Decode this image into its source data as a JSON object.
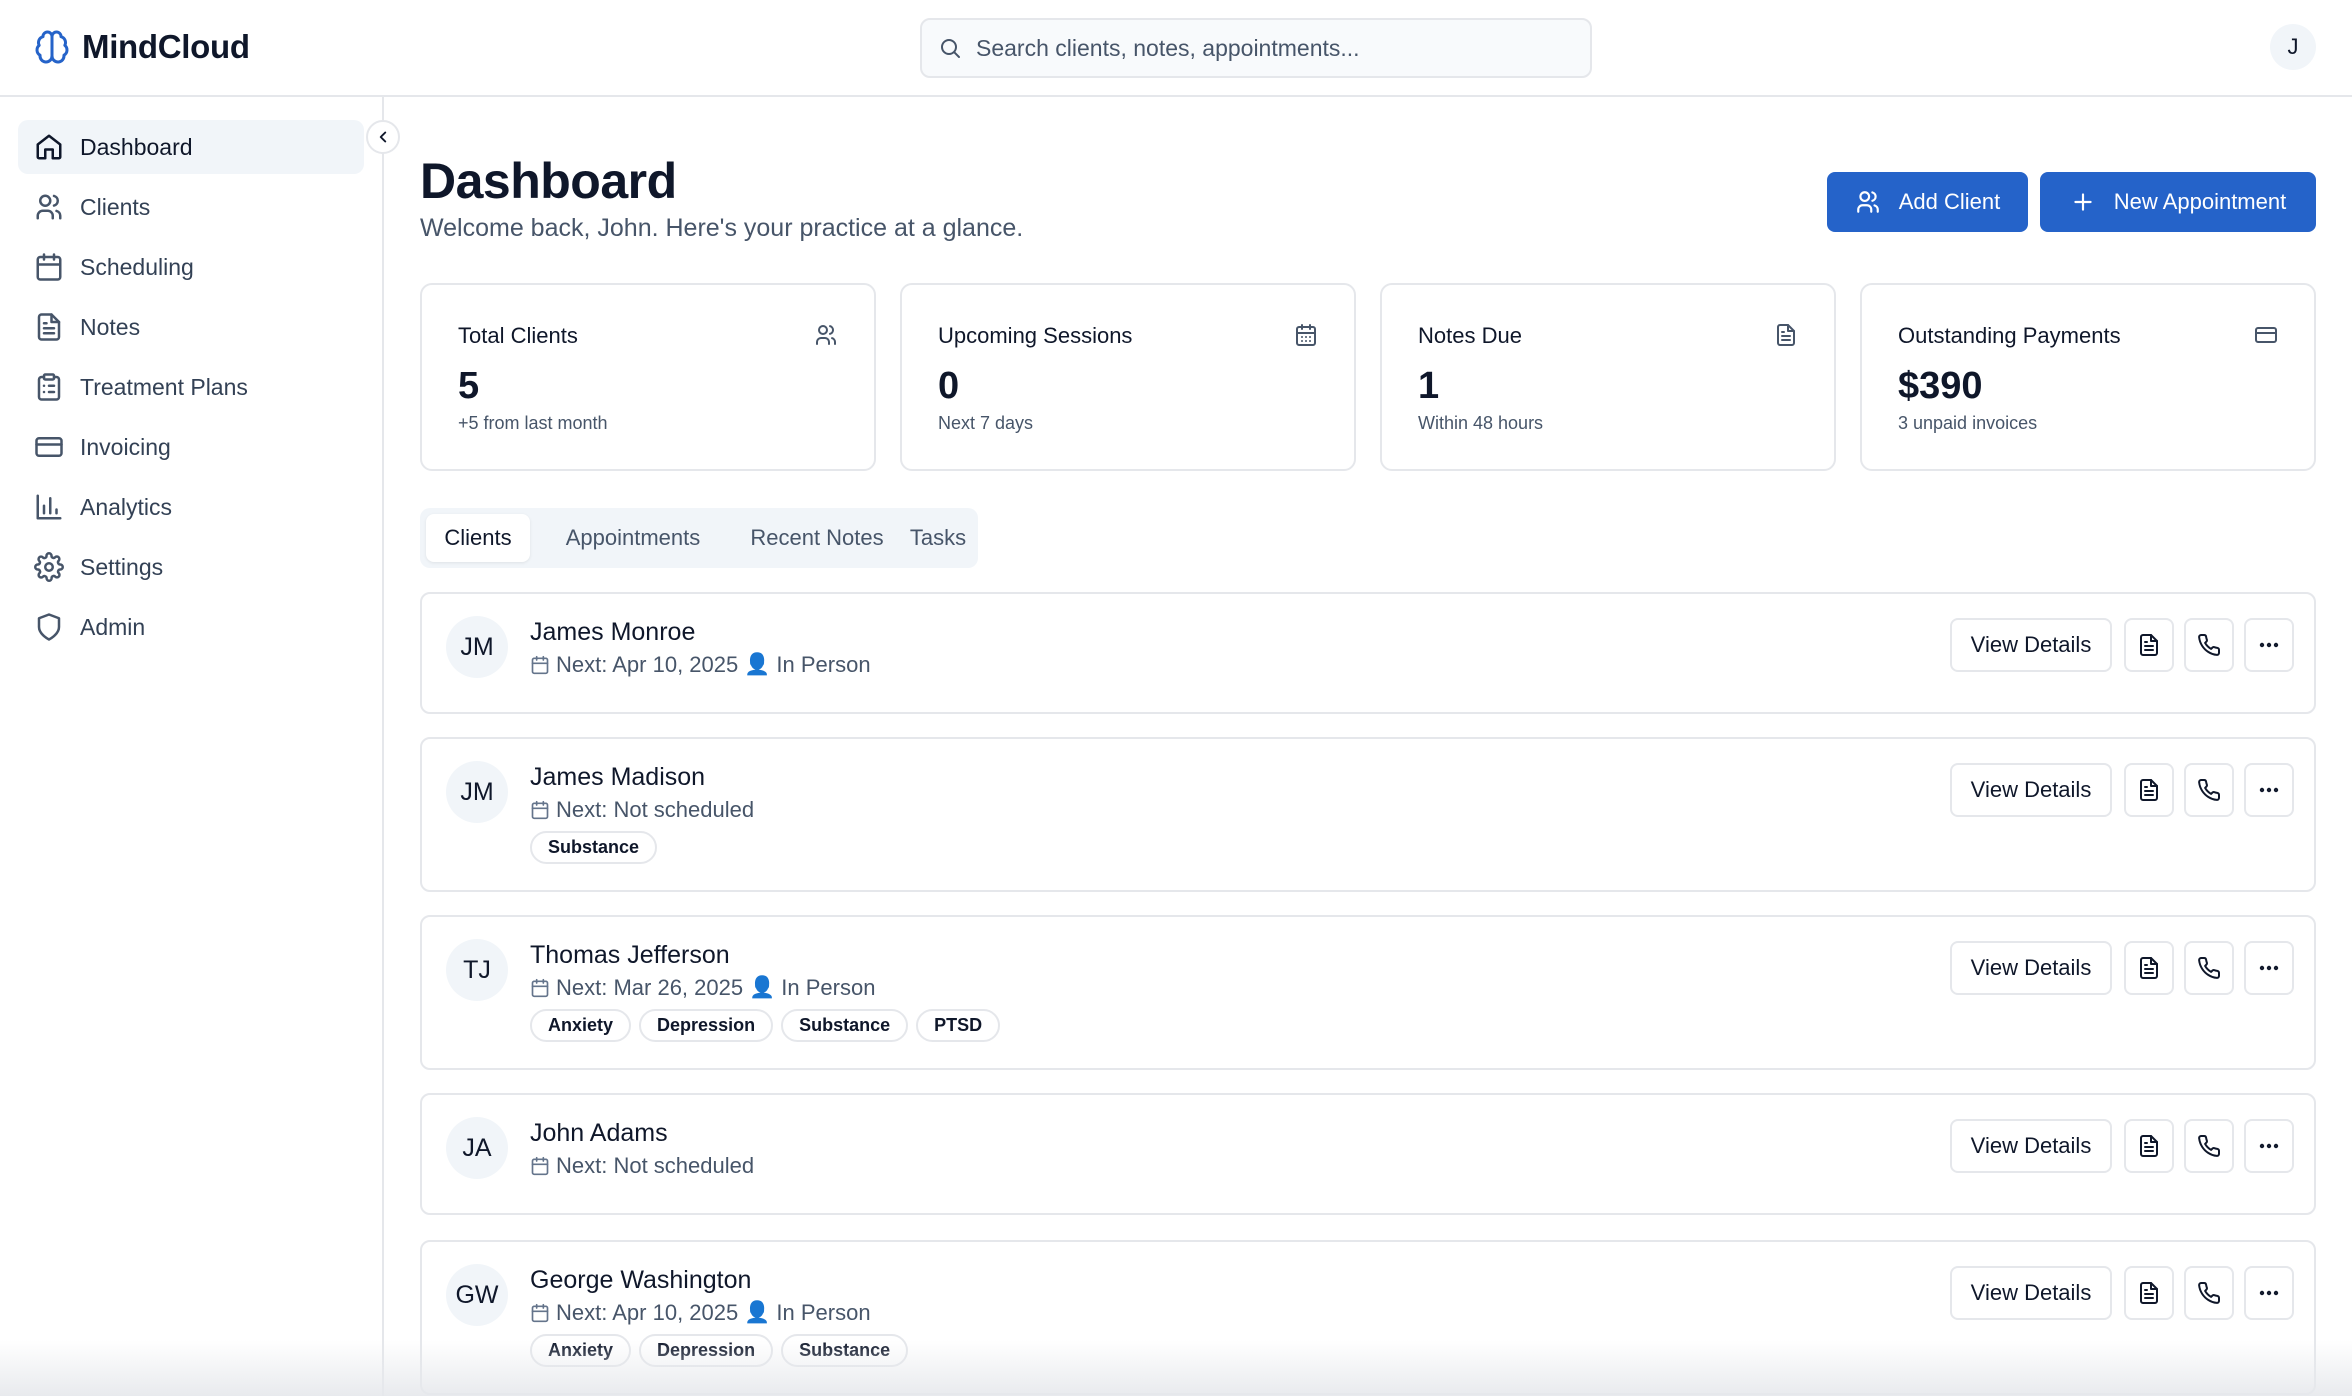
{
  "app": {
    "name": "MindCloud"
  },
  "search": {
    "placeholder": "Search clients, notes, appointments..."
  },
  "user": {
    "initial": "J"
  },
  "sidebar": {
    "items": [
      {
        "label": "Dashboard",
        "icon": "home-icon",
        "active": true
      },
      {
        "label": "Clients",
        "icon": "users-icon"
      },
      {
        "label": "Scheduling",
        "icon": "calendar-icon"
      },
      {
        "label": "Notes",
        "icon": "file-text-icon"
      },
      {
        "label": "Treatment Plans",
        "icon": "clipboard-icon"
      },
      {
        "label": "Invoicing",
        "icon": "credit-card-icon"
      },
      {
        "label": "Analytics",
        "icon": "bar-chart-icon"
      },
      {
        "label": "Settings",
        "icon": "gear-icon"
      },
      {
        "label": "Admin",
        "icon": "shield-icon"
      }
    ]
  },
  "page": {
    "title": "Dashboard",
    "subtitle": "Welcome back, John. Here's your practice at a glance.",
    "add_client_label": "Add Client",
    "new_appointment_label": "New Appointment"
  },
  "stats": [
    {
      "label": "Total Clients",
      "value": "5",
      "sub": "+5 from last month",
      "icon": "users-icon"
    },
    {
      "label": "Upcoming Sessions",
      "value": "0",
      "sub": "Next 7 days",
      "icon": "calendar-icon"
    },
    {
      "label": "Notes Due",
      "value": "1",
      "sub": "Within 48 hours",
      "icon": "file-text-icon"
    },
    {
      "label": "Outstanding Payments",
      "value": "$390",
      "sub": "3 unpaid invoices",
      "icon": "credit-card-icon"
    }
  ],
  "tabs": [
    "Clients",
    "Appointments",
    "Recent Notes",
    "Tasks"
  ],
  "clients": [
    {
      "initials": "JM",
      "name": "James Monroe",
      "next": "Next: Apr 10, 2025",
      "mode": "In Person",
      "tags": []
    },
    {
      "initials": "JM",
      "name": "James Madison",
      "next": "Next: Not scheduled",
      "mode": "",
      "tags": [
        "Substance"
      ]
    },
    {
      "initials": "TJ",
      "name": "Thomas Jefferson",
      "next": "Next: Mar 26, 2025",
      "mode": "In Person",
      "tags": [
        "Anxiety",
        "Depression",
        "Substance",
        "PTSD"
      ]
    },
    {
      "initials": "JA",
      "name": "John Adams",
      "next": "Next: Not scheduled",
      "mode": "",
      "tags": []
    },
    {
      "initials": "GW",
      "name": "George Washington",
      "next": "Next: Apr 10, 2025",
      "mode": "In Person",
      "tags": [
        "Anxiety",
        "Depression",
        "Substance"
      ]
    }
  ],
  "client_actions": {
    "view_details_label": "View Details",
    "person_glyph": "👤"
  },
  "colors": {
    "primary": "#2563c9",
    "muted_text": "#475569",
    "border": "#e5e7eb",
    "active_bg": "#f1f5f9"
  }
}
